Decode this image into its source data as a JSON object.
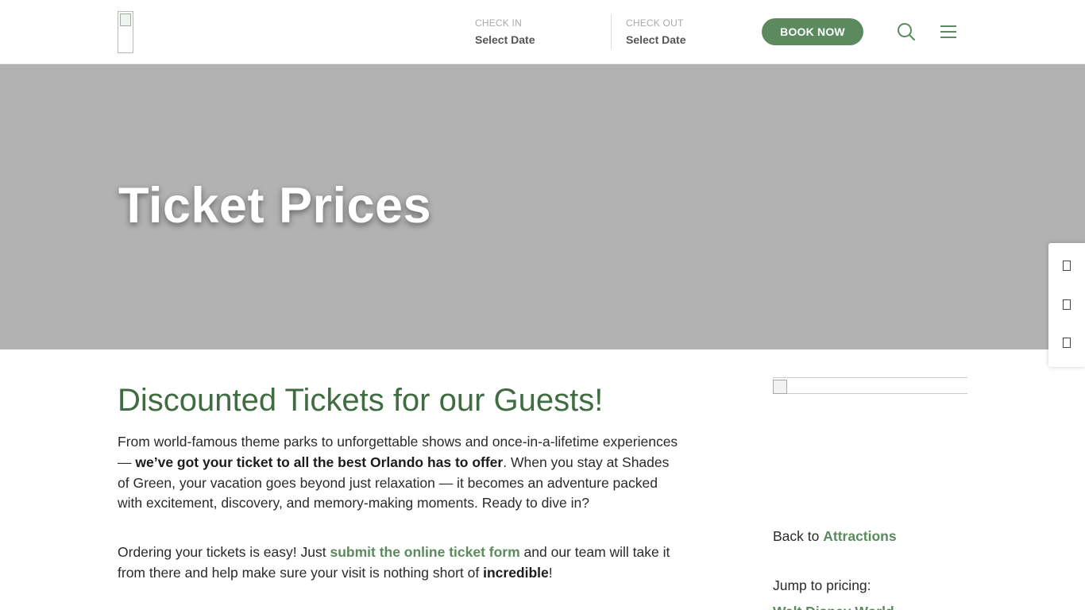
{
  "header": {
    "check_in": {
      "label": "CHECK IN",
      "value": "Select Date"
    },
    "check_out": {
      "label": "CHECK OUT",
      "value": "Select Date"
    },
    "book_now": "BOOK NOW",
    "icons": [
      "search-icon",
      "menu-icon"
    ]
  },
  "hero": {
    "title": "Ticket Prices"
  },
  "main": {
    "title": "Discounted Tickets for our Guests!",
    "para1": {
      "text_1": "From world-famous theme parks to unforgettable shows and once-in-a-lifetime experiences — ",
      "bold_1": "we’ve got your ticket to all the best Orlando has to offer",
      "text_2": ". When you stay at Shades of Green, your vacation goes beyond just relaxation — it becomes an adventure packed with excitement, discovery, and memory-making moments. Ready to dive in?"
    },
    "para2": {
      "text_1": "Ordering your tickets is easy! Just ",
      "link": "submit the online ticket form",
      "text_2": " and our team will take it from there and help make sure your visit is nothing short of ",
      "bold": "incredible",
      "text_3": "!"
    }
  },
  "sidebar": {
    "back_prefix": "Back to ",
    "back_link": "Attractions",
    "jump_label": "Jump to pricing:",
    "jump_first": "Walt Disney World"
  },
  "colors": {
    "brand_green": "#5a8a5e",
    "title_green": "#3f6d41",
    "hero_gray": "#b2b2b2"
  }
}
